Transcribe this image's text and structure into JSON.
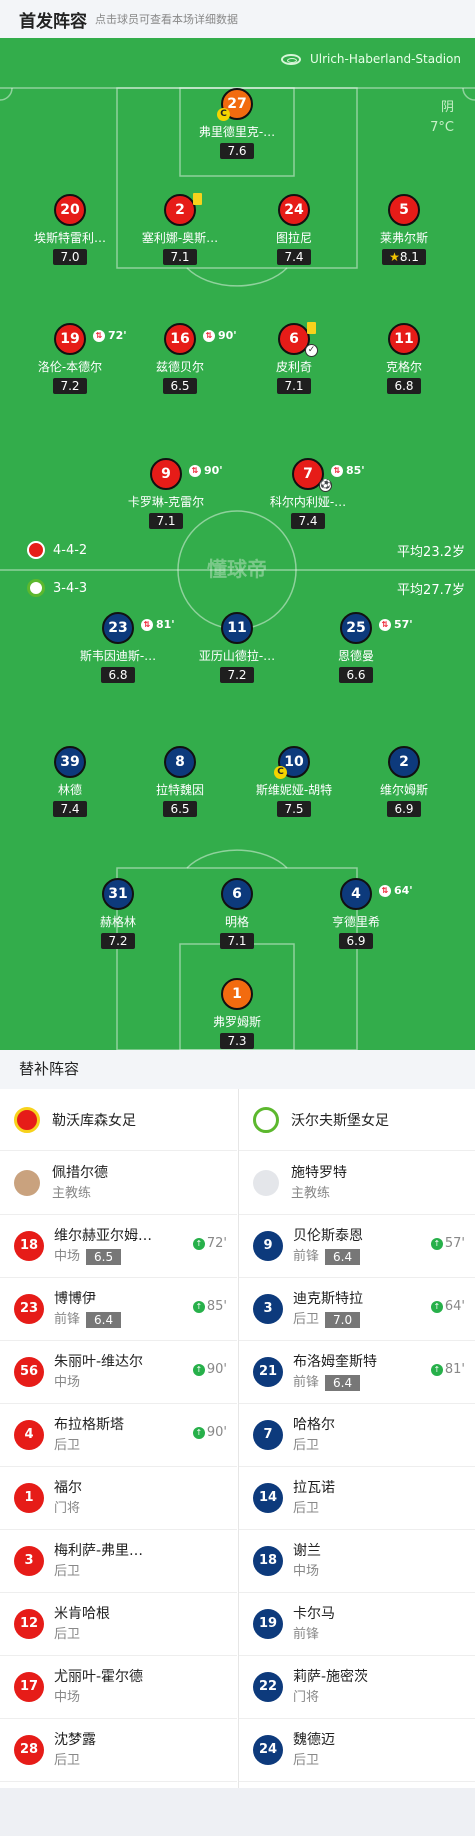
{
  "header": {
    "title": "首发阵容",
    "subtitle": "点击球员可查看本场详细数据"
  },
  "pitch": {
    "stadium": "Ulrich-Haberland-Stadion",
    "weather": "阴",
    "temperature": "7°C",
    "watermark": "懂球帝",
    "home_team": {
      "formation": "4-4-2",
      "avg_age": "平均23.2岁",
      "color": "#e61c18"
    },
    "away_team": {
      "formation": "3-4-3",
      "avg_age": "平均27.7岁",
      "color": "#0d3a7c"
    }
  },
  "home_players": [
    {
      "num": "27",
      "name": "弗里德里克-…",
      "rating": "7.6",
      "captain": "C"
    },
    {
      "num": "20",
      "name": "埃斯特雷利…",
      "rating": "7.0"
    },
    {
      "num": "2",
      "name": "塞利娜-奥斯…",
      "rating": "7.1"
    },
    {
      "num": "24",
      "name": "图拉尼",
      "rating": "7.4"
    },
    {
      "num": "5",
      "name": "莱弗尔斯",
      "rating": "8.1"
    },
    {
      "num": "19",
      "name": "洛伦-本德尔",
      "rating": "7.2",
      "sub": "72'"
    },
    {
      "num": "16",
      "name": "兹德贝尔",
      "rating": "6.5",
      "sub": "90'"
    },
    {
      "num": "6",
      "name": "皮利奇",
      "rating": "7.1"
    },
    {
      "num": "11",
      "name": "克格尔",
      "rating": "6.8"
    },
    {
      "num": "9",
      "name": "卡罗琳-克雷尔",
      "rating": "7.1",
      "sub": "90'"
    },
    {
      "num": "7",
      "name": "科尔内利娅-…",
      "rating": "7.4",
      "sub": "85'"
    }
  ],
  "away_players": [
    {
      "num": "23",
      "name": "斯韦因迪斯-…",
      "rating": "6.8",
      "sub": "81'"
    },
    {
      "num": "11",
      "name": "亚历山德拉-…",
      "rating": "7.2"
    },
    {
      "num": "25",
      "name": "恩德曼",
      "rating": "6.6",
      "sub": "57'"
    },
    {
      "num": "39",
      "name": "林德",
      "rating": "7.4"
    },
    {
      "num": "8",
      "name": "拉特魏因",
      "rating": "6.5"
    },
    {
      "num": "10",
      "name": "斯维妮娅-胡特",
      "rating": "7.5",
      "captain": "C"
    },
    {
      "num": "2",
      "name": "维尔姆斯",
      "rating": "6.9"
    },
    {
      "num": "31",
      "name": "赫格林",
      "rating": "7.2"
    },
    {
      "num": "6",
      "name": "明格",
      "rating": "7.1"
    },
    {
      "num": "4",
      "name": "亨德里希",
      "rating": "6.9",
      "sub": "64'"
    },
    {
      "num": "1",
      "name": "弗罗姆斯",
      "rating": "7.3"
    }
  ],
  "bench": {
    "title": "替补阵容",
    "home": {
      "team": "勒沃库森女足",
      "coach": {
        "name": "佩措尔德",
        "role": "主教练"
      },
      "players": [
        {
          "num": "18",
          "name": "维尔赫亚尔姆…",
          "pos": "中场",
          "rating": "6.5",
          "min": "72'"
        },
        {
          "num": "23",
          "name": "博博伊",
          "pos": "前锋",
          "rating": "6.4",
          "min": "85'"
        },
        {
          "num": "56",
          "name": "朱丽叶-维达尔",
          "pos": "中场",
          "min": "90'"
        },
        {
          "num": "4",
          "name": "布拉格斯塔",
          "pos": "后卫",
          "min": "90'"
        },
        {
          "num": "1",
          "name": "福尔",
          "pos": "门将"
        },
        {
          "num": "3",
          "name": "梅利萨-弗里…",
          "pos": "后卫"
        },
        {
          "num": "12",
          "name": "米肯哈根",
          "pos": "后卫"
        },
        {
          "num": "17",
          "name": "尤丽叶-霍尔德",
          "pos": "中场"
        },
        {
          "num": "28",
          "name": "沈梦露",
          "pos": "后卫"
        }
      ]
    },
    "away": {
      "team": "沃尔夫斯堡女足",
      "coach": {
        "name": "施特罗特",
        "role": "主教练"
      },
      "players": [
        {
          "num": "9",
          "name": "贝伦斯泰恩",
          "pos": "前锋",
          "rating": "6.4",
          "min": "57'"
        },
        {
          "num": "3",
          "name": "迪克斯特拉",
          "pos": "后卫",
          "rating": "7.0",
          "min": "64'"
        },
        {
          "num": "21",
          "name": "布洛姆奎斯特",
          "pos": "前锋",
          "rating": "6.4",
          "min": "81'"
        },
        {
          "num": "7",
          "name": "哈格尔",
          "pos": "后卫"
        },
        {
          "num": "14",
          "name": "拉瓦诺",
          "pos": "后卫"
        },
        {
          "num": "18",
          "name": "谢兰",
          "pos": "中场"
        },
        {
          "num": "19",
          "name": "卡尔马",
          "pos": "前锋"
        },
        {
          "num": "22",
          "name": "莉萨-施密茨",
          "pos": "门将"
        },
        {
          "num": "24",
          "name": "魏德迈",
          "pos": "后卫"
        }
      ]
    }
  }
}
